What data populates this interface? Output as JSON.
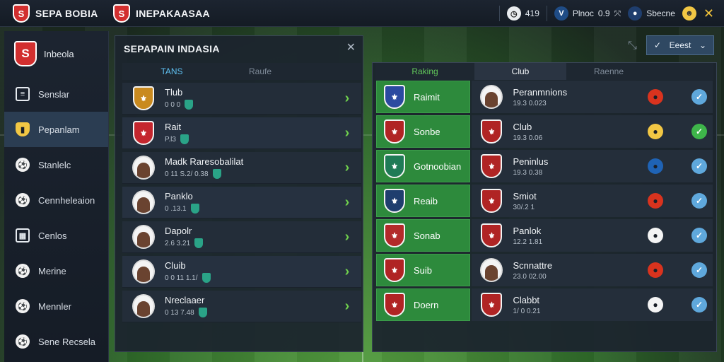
{
  "topbar": {
    "brand_left": "SEPA BOBIA",
    "brand_center": "INEPAKAASAA",
    "stat1": "419",
    "stat2_label": "Plnoc",
    "stat2_value": "0.9",
    "stat3_label": "Sbecne"
  },
  "sidebar": {
    "header_label": "Inbeola",
    "items": [
      {
        "label": "Senslar",
        "icon": "list-icon"
      },
      {
        "label": "Pepanlam",
        "icon": "shield-icon",
        "active": true
      },
      {
        "label": "Stanlelc",
        "icon": "ball-icon"
      },
      {
        "label": "Cennheleaion",
        "icon": "ball-icon"
      },
      {
        "label": "Cenlos",
        "icon": "grid-icon"
      },
      {
        "label": "Merine",
        "icon": "ball-icon"
      },
      {
        "label": "Mennler",
        "icon": "ball-icon"
      },
      {
        "label": "Sene Recsela",
        "icon": "ball-icon"
      }
    ]
  },
  "left_panel": {
    "title": "SEPAPAIN INDASIA",
    "tabs": [
      "TANS",
      "Raufe"
    ],
    "rows": [
      {
        "name": "Tlub",
        "meta": "0 0 0",
        "kind": "crest",
        "color": "#c98a1f"
      },
      {
        "name": "Rait",
        "meta": "P.l3",
        "kind": "crest",
        "color": "#c4262e"
      },
      {
        "name": "Madk Raresobalilat",
        "meta": "0 11  S.2/ 0.38",
        "kind": "avatar",
        "color": "#f4f4f4"
      },
      {
        "name": "Panklo",
        "meta": "0 .13.1",
        "kind": "avatar",
        "color": "#f4f4f4"
      },
      {
        "name": "Dapolr",
        "meta": "2.6 3.21",
        "kind": "avatar",
        "color": "#f4f4f4"
      },
      {
        "name": "Cluib",
        "meta": "0 0 11  1.1/",
        "kind": "avatar",
        "color": "#f4f4f4"
      },
      {
        "name": "Nreclaaer",
        "meta": "0 13  7.48",
        "kind": "avatar",
        "color": "#f4f4f4"
      }
    ]
  },
  "right_panel": {
    "select_label": "Eeest",
    "tabs": [
      "Raking",
      "Club",
      "Raenne"
    ],
    "rows": [
      {
        "left_name": "Raimit",
        "left_color": "#2b4aa0",
        "right_name": "Peranmnions",
        "right_meta": "19.3 0.023",
        "right_kind": "avatar",
        "status_color": "#d9331e",
        "check": "blue"
      },
      {
        "left_name": "Sonbe",
        "left_color": "#b02424",
        "right_name": "Club",
        "right_meta": "19.3 0.06",
        "right_kind": "crest",
        "status_color": "#f2c744",
        "check": "green"
      },
      {
        "left_name": "Gotnoobian",
        "left_color": "#1f7b56",
        "right_name": "Peninlus",
        "right_meta": "19.3 0.38",
        "right_kind": "crest",
        "status_color": "#1f63b5",
        "check": "blue"
      },
      {
        "left_name": "Reaib",
        "left_color": "#1f3e6e",
        "right_name": "Smiot",
        "right_meta": "30/.2 1",
        "right_kind": "crest",
        "status_color": "#d9331e",
        "check": "blue"
      },
      {
        "left_name": "Sonab",
        "left_color": "#b32a2a",
        "right_name": "Panlok",
        "right_meta": "12.2 1.81",
        "right_kind": "crest",
        "status_color": "#f4f4f4",
        "check": "blue"
      },
      {
        "left_name": "Suib",
        "left_color": "#b02424",
        "right_name": "Scnnattre",
        "right_meta": "23.0 02.00",
        "right_kind": "avatar",
        "status_color": "#d9331e",
        "check": "blue"
      },
      {
        "left_name": "Doern",
        "left_color": "#b02424",
        "right_name": "Clabbt",
        "right_meta": "1/ 0 0.21",
        "right_kind": "crest",
        "status_color": "#f4f4f4",
        "check": "blue"
      }
    ]
  }
}
